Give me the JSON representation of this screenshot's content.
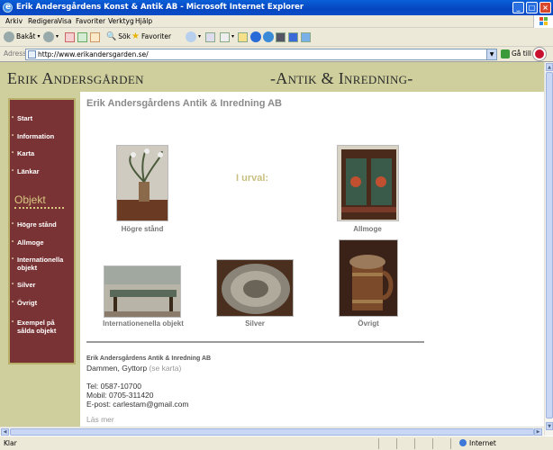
{
  "window": {
    "title": "Erik Andersgårdens Konst & Antik AB - Microsoft Internet Explorer"
  },
  "menubar": [
    "Arkiv",
    "Redigera",
    "Visa",
    "Favoriter",
    "Verktyg",
    "Hjälp"
  ],
  "toolbar": {
    "back": "Bakåt",
    "search": "Sök",
    "favorites": "Favoriter"
  },
  "address": {
    "label": "Adress",
    "url": "http://www.erikandersgarden.se/",
    "go": "Gå till"
  },
  "site": {
    "title": "Erik Andersgården",
    "subtitle": "-Antik & Inredning-",
    "page_heading": "Erik Andersgårdens Antik & Inredning AB",
    "highlight": "I urval:",
    "nav": [
      "Start",
      "Information",
      "Karta",
      "Länkar"
    ],
    "objekt_heading": "Objekt",
    "objekt_nav": [
      "Högre stånd",
      "Allmoge",
      "Internationella objekt",
      "Silver",
      "Övrigt",
      "Exempel på sålda objekt"
    ],
    "gallery": [
      "Högre stånd",
      "Allmoge",
      "Internationenella objekt",
      "Silver",
      "Övrigt"
    ],
    "footer": {
      "company": "Erik Andersgårdens Antik & Inredning AB",
      "address": "Dammen, Gyttorp",
      "map_link": "(se karta)",
      "tel": "Tel: 0587-10700",
      "mobile": "Mobil: 0705-311420",
      "email": "E-post: carlestam@gmail.com",
      "more": "Läs mer"
    }
  },
  "status": {
    "left": "Klar",
    "zone": "Internet"
  }
}
